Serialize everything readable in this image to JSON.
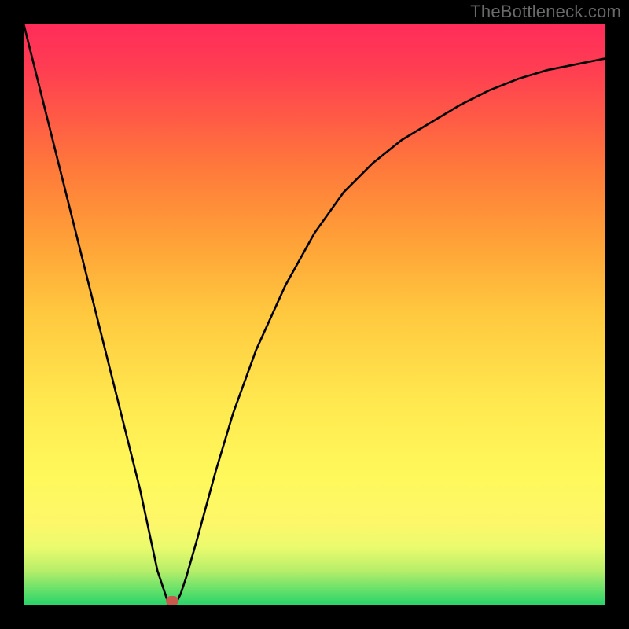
{
  "watermark": "TheBottleneck.com",
  "chart_data": {
    "type": "line",
    "title": "",
    "xlabel": "",
    "ylabel": "",
    "xlim": [
      0,
      100
    ],
    "ylim": [
      0,
      100
    ],
    "grid": false,
    "legend": false,
    "background_gradient": {
      "bottom": "#27d36a",
      "mid": "#fff95c",
      "top": "#ff2c5a"
    },
    "series": [
      {
        "name": "bottleneck-curve",
        "x": [
          0,
          5,
          10,
          15,
          20,
          23,
          25,
          26,
          27,
          28,
          30,
          33,
          36,
          40,
          45,
          50,
          55,
          60,
          65,
          70,
          75,
          80,
          85,
          90,
          95,
          100
        ],
        "values": [
          100,
          80,
          60,
          40,
          20,
          6,
          0,
          0,
          2,
          5,
          12,
          23,
          33,
          44,
          55,
          64,
          71,
          76,
          80,
          83,
          86,
          88.5,
          90.5,
          92,
          93,
          94
        ]
      }
    ],
    "marker": {
      "x": 25.5,
      "y": 0.8,
      "name": "optimal-point"
    }
  }
}
